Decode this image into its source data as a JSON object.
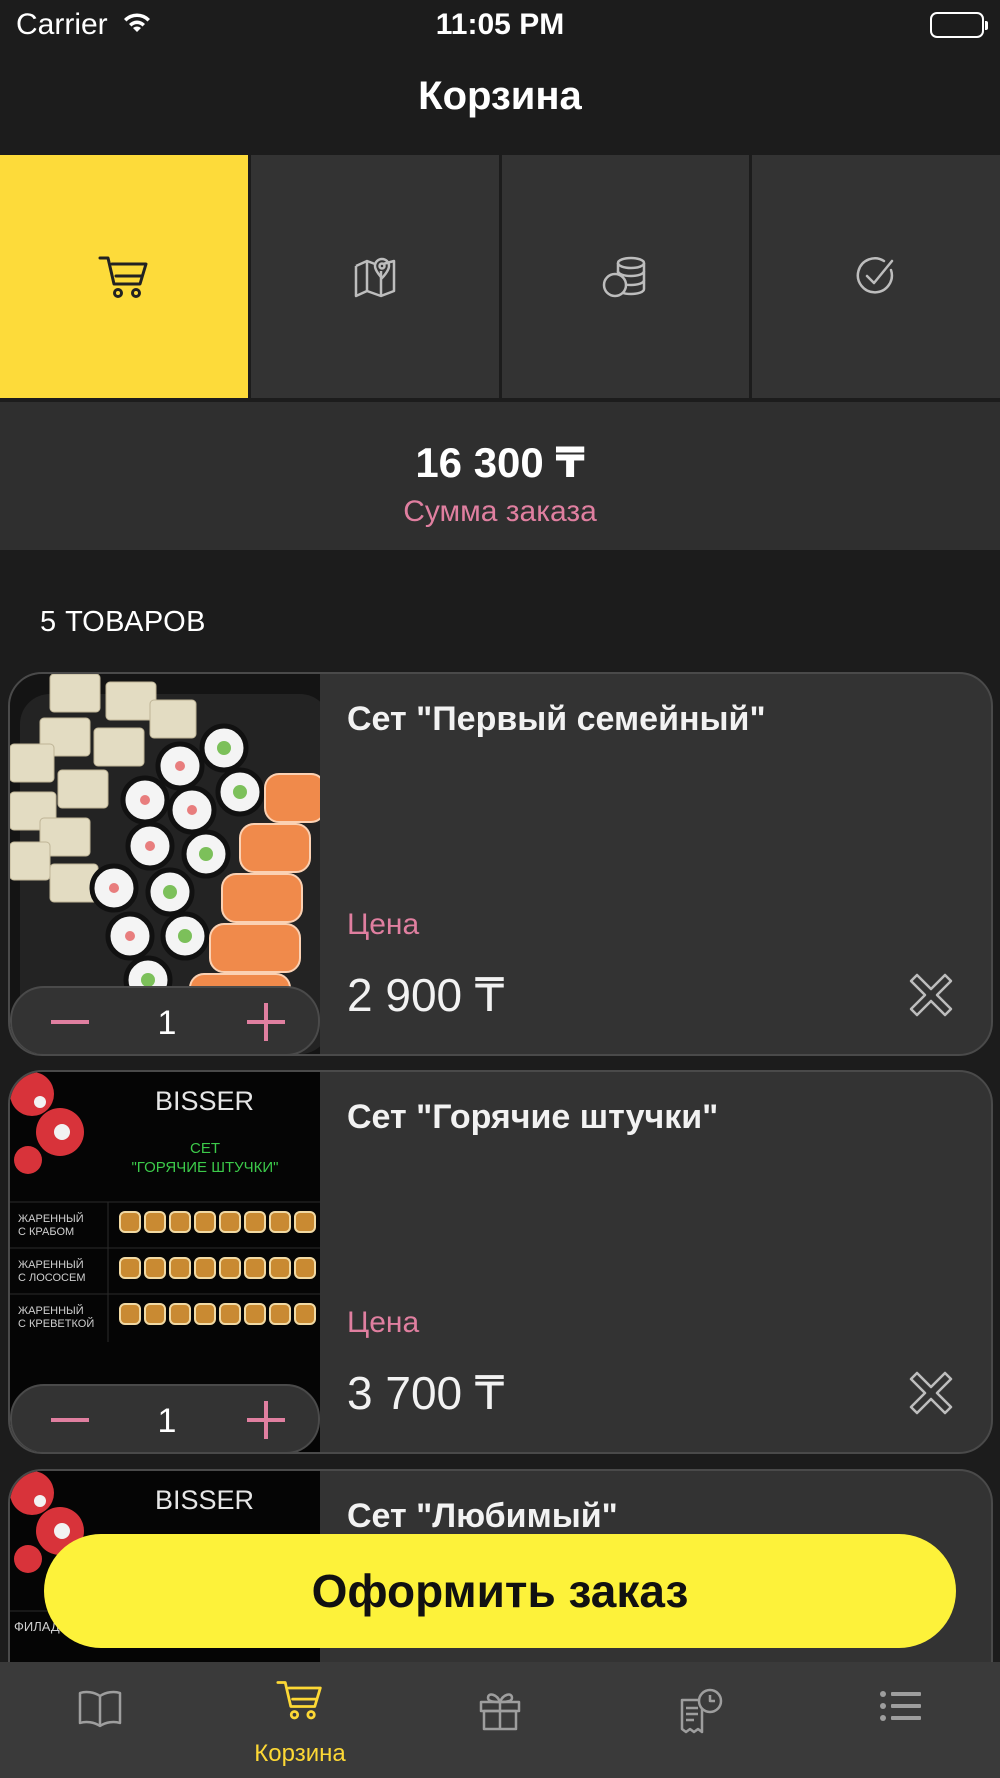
{
  "status_bar": {
    "carrier": "Carrier",
    "time": "11:05 PM"
  },
  "nav": {
    "title": "Корзина"
  },
  "steps": [
    {
      "icon": "cart-icon",
      "active": true
    },
    {
      "icon": "map-pin-icon",
      "active": false
    },
    {
      "icon": "coins-icon",
      "active": false
    },
    {
      "icon": "check-circle-icon",
      "active": false
    }
  ],
  "summary": {
    "total": "16 300 ₸",
    "label": "Сумма заказа"
  },
  "items_count": "5 ТОВАРОВ",
  "items": [
    {
      "name": "Сет \"Первый семейный\"",
      "price_label": "Цена",
      "price": "2 900 ₸",
      "quantity": "1"
    },
    {
      "name": "Сет \"Горячие штучки\"",
      "price_label": "Цена",
      "price": "3 700 ₸",
      "quantity": "1",
      "image_text": {
        "brand": "BISSER",
        "set_name": "СЕТ\n\"ГОРЯЧИЕ ШТУЧКИ\"",
        "rows": [
          "ЖАРЕННЫЙ С КРАБОМ",
          "ЖАРЕННЫЙ С ЛОСОСЕМ",
          "ЖАРЕННЫЙ С КРЕВЕТКОЙ"
        ]
      }
    },
    {
      "name": "Сет \"Любимый\"",
      "image_text": {
        "brand": "BISSER",
        "row": "ФИЛАДЕ"
      }
    }
  ],
  "checkout": {
    "label": "Оформить заказ"
  },
  "tabbar": [
    {
      "icon": "menu-book-icon",
      "label": "",
      "active": false
    },
    {
      "icon": "cart-icon",
      "label": "Корзина",
      "active": true
    },
    {
      "icon": "gift-icon",
      "label": "",
      "active": false
    },
    {
      "icon": "order-history-icon",
      "label": "",
      "active": false
    },
    {
      "icon": "list-icon",
      "label": "",
      "active": false
    }
  ],
  "colors": {
    "accent_yellow": "#fddb3a",
    "button_yellow": "#fdf23a",
    "pink": "#e07fa0",
    "card_bg": "#333333",
    "page_bg": "#1c1c1c"
  }
}
